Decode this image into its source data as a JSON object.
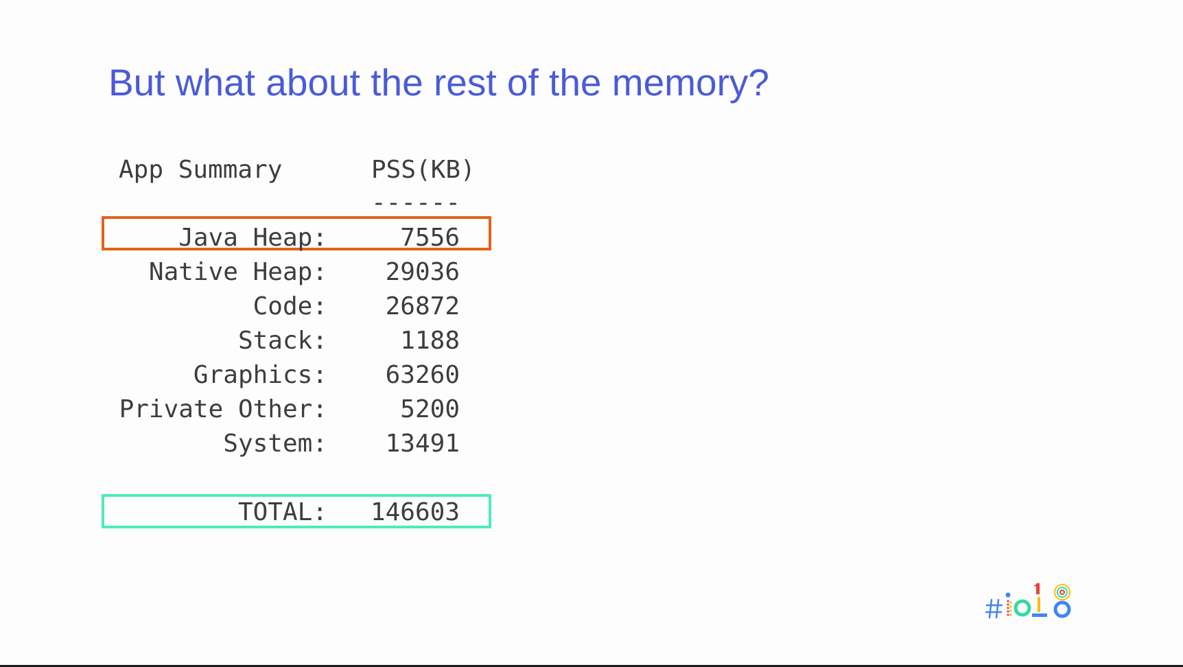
{
  "slide": {
    "title": "But what about the rest of the memory?"
  },
  "table": {
    "header_label": "App Summary",
    "header_column": "PSS(KB)",
    "header_underline": "------",
    "rows": [
      {
        "label": "Java Heap:",
        "value": "7556"
      },
      {
        "label": "Native Heap:",
        "value": "29036"
      },
      {
        "label": "Code:",
        "value": "26872"
      },
      {
        "label": "Stack:",
        "value": "1188"
      },
      {
        "label": "Graphics:",
        "value": "63260"
      },
      {
        "label": "Private Other:",
        "value": "5200"
      },
      {
        "label": "System:",
        "value": "13491"
      }
    ],
    "total": {
      "label": "TOTAL:",
      "value": "146603"
    }
  },
  "highlights": {
    "java_heap_color": "#e2621b",
    "total_color": "#4eebbd"
  },
  "colors": {
    "title": "#4a5bd8",
    "text": "#3d3d3d",
    "background": "#fdfdfd"
  },
  "logo": {
    "icon": "google-io-18-logo"
  }
}
